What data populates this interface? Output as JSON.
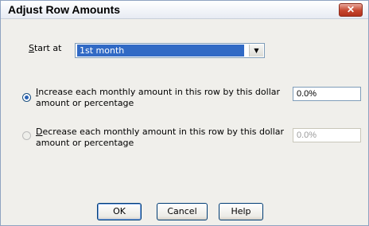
{
  "dialog": {
    "title": "Adjust Row Amounts",
    "close_glyph": "✕"
  },
  "start_at": {
    "label_accel": "S",
    "label_rest": "tart at",
    "selected": "1st month"
  },
  "increase": {
    "selected": true,
    "line1_accel": "I",
    "line1_rest": "ncrease each monthly amount in this row by this dollar",
    "line2": "amount or percentage",
    "value": "0.0%"
  },
  "decrease": {
    "selected": false,
    "line1_accel": "D",
    "line1_rest": "ecrease each monthly amount in this row by this dollar",
    "line2": "amount or percentage",
    "value": "0.0%"
  },
  "buttons": {
    "ok": "OK",
    "cancel": "Cancel",
    "help": "Help"
  }
}
